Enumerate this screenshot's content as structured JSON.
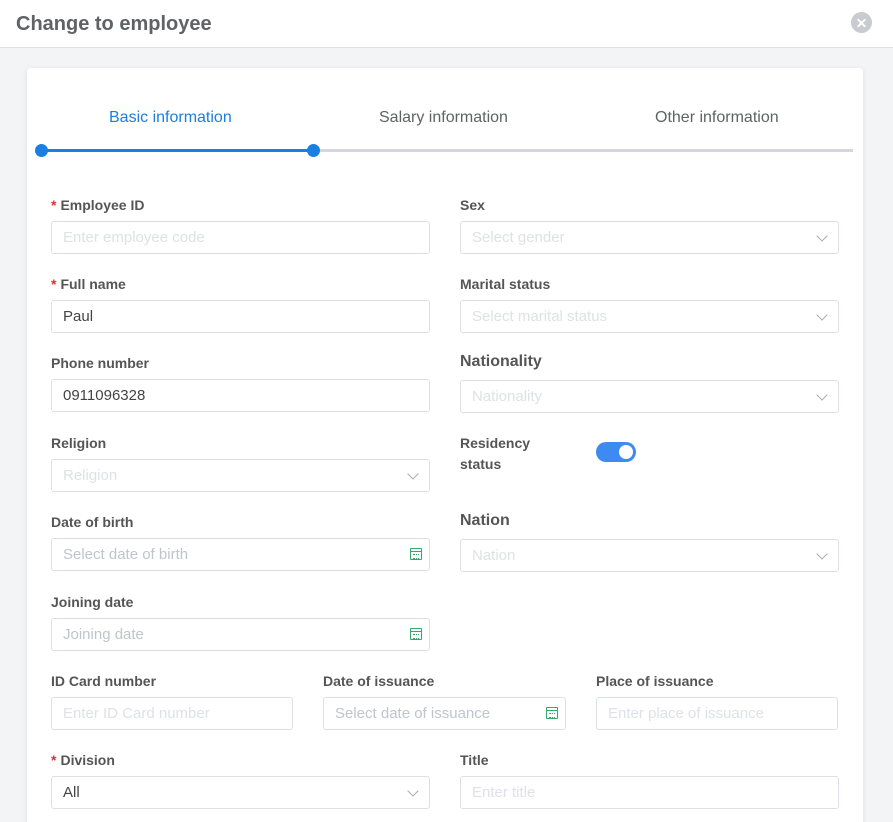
{
  "dialog": {
    "title": "Change to employee"
  },
  "tabs": [
    "Basic information",
    "Salary information",
    "Other information"
  ],
  "form": {
    "employee_id": {
      "label": "Employee ID",
      "placeholder": "Enter employee code",
      "required": true
    },
    "sex": {
      "label": "Sex",
      "placeholder": "Select gender"
    },
    "full_name": {
      "label": "Full name",
      "value": "Paul",
      "required": true
    },
    "marital_status": {
      "label": "Marital status",
      "placeholder": "Select marital status"
    },
    "phone_number": {
      "label": "Phone number",
      "value": "0911096328"
    },
    "nationality": {
      "label": "Nationality",
      "placeholder": "Nationality"
    },
    "religion": {
      "label": "Religion",
      "placeholder": "Religion"
    },
    "residency_status": {
      "label_line1": "Residency",
      "label_line2": "status",
      "enabled": true
    },
    "date_of_birth": {
      "label": "Date of birth",
      "placeholder": "Select date of birth"
    },
    "nation": {
      "label": "Nation",
      "placeholder": "Nation"
    },
    "joining_date": {
      "label": "Joining date",
      "placeholder": "Joining date"
    },
    "id_card_number": {
      "label": "ID Card number",
      "placeholder": "Enter ID Card number"
    },
    "date_of_issuance": {
      "label": "Date of issuance",
      "placeholder": "Select date of issuance"
    },
    "place_of_issuance": {
      "label": "Place of issuance",
      "placeholder": "Enter place of issuance"
    },
    "division": {
      "label": "Division",
      "value": "All",
      "required": true
    },
    "title_field": {
      "label": "Title",
      "placeholder": "Enter title"
    }
  },
  "colors": {
    "accent": "#1a7fe0",
    "required": "#e03131",
    "toggle_on": "#3d8bf0",
    "calendar_icon": "#36a86c"
  },
  "icons": {
    "close": "close-icon",
    "dropdown": "chevron-down-icon",
    "date": "calendar-icon"
  }
}
